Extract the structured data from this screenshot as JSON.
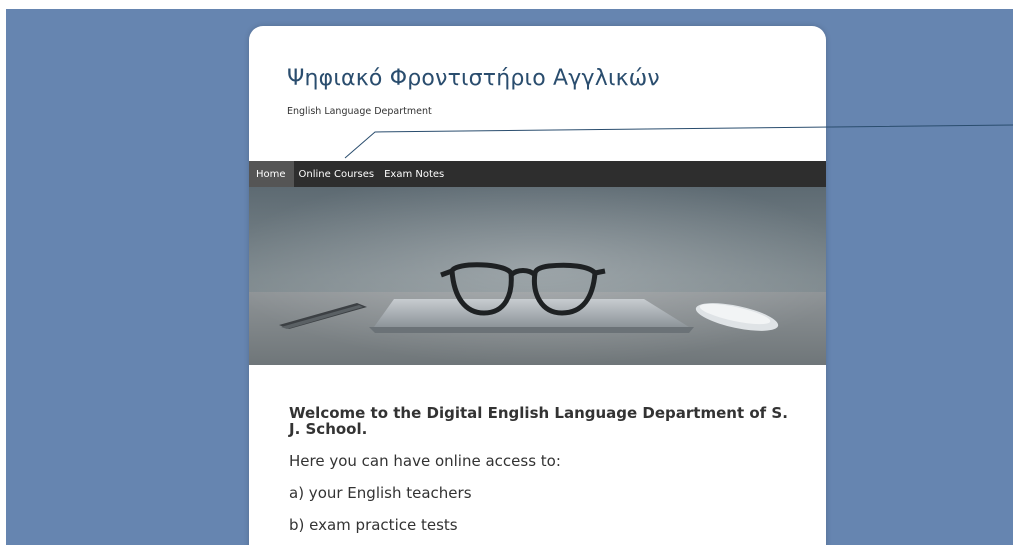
{
  "site": {
    "title": "Ψηφιακό Φροντιστήριο Αγγλικών",
    "subtitle": "English Language Department"
  },
  "nav": {
    "items": [
      {
        "label": "Home",
        "active": true
      },
      {
        "label": "Online Courses",
        "active": false
      },
      {
        "label": "Exam Notes",
        "active": false
      }
    ]
  },
  "content": {
    "welcome": "Welcome to the Digital English Language Department of S. J. School.",
    "intro": "Here you can have online access to:",
    "items": [
      "a) your English teachers",
      "b) exam practice tests"
    ]
  },
  "colors": {
    "page_background": "#6685b0",
    "title": "#2a4d6e",
    "nav_bar": "#2e2e2e",
    "nav_active": "#555555"
  }
}
